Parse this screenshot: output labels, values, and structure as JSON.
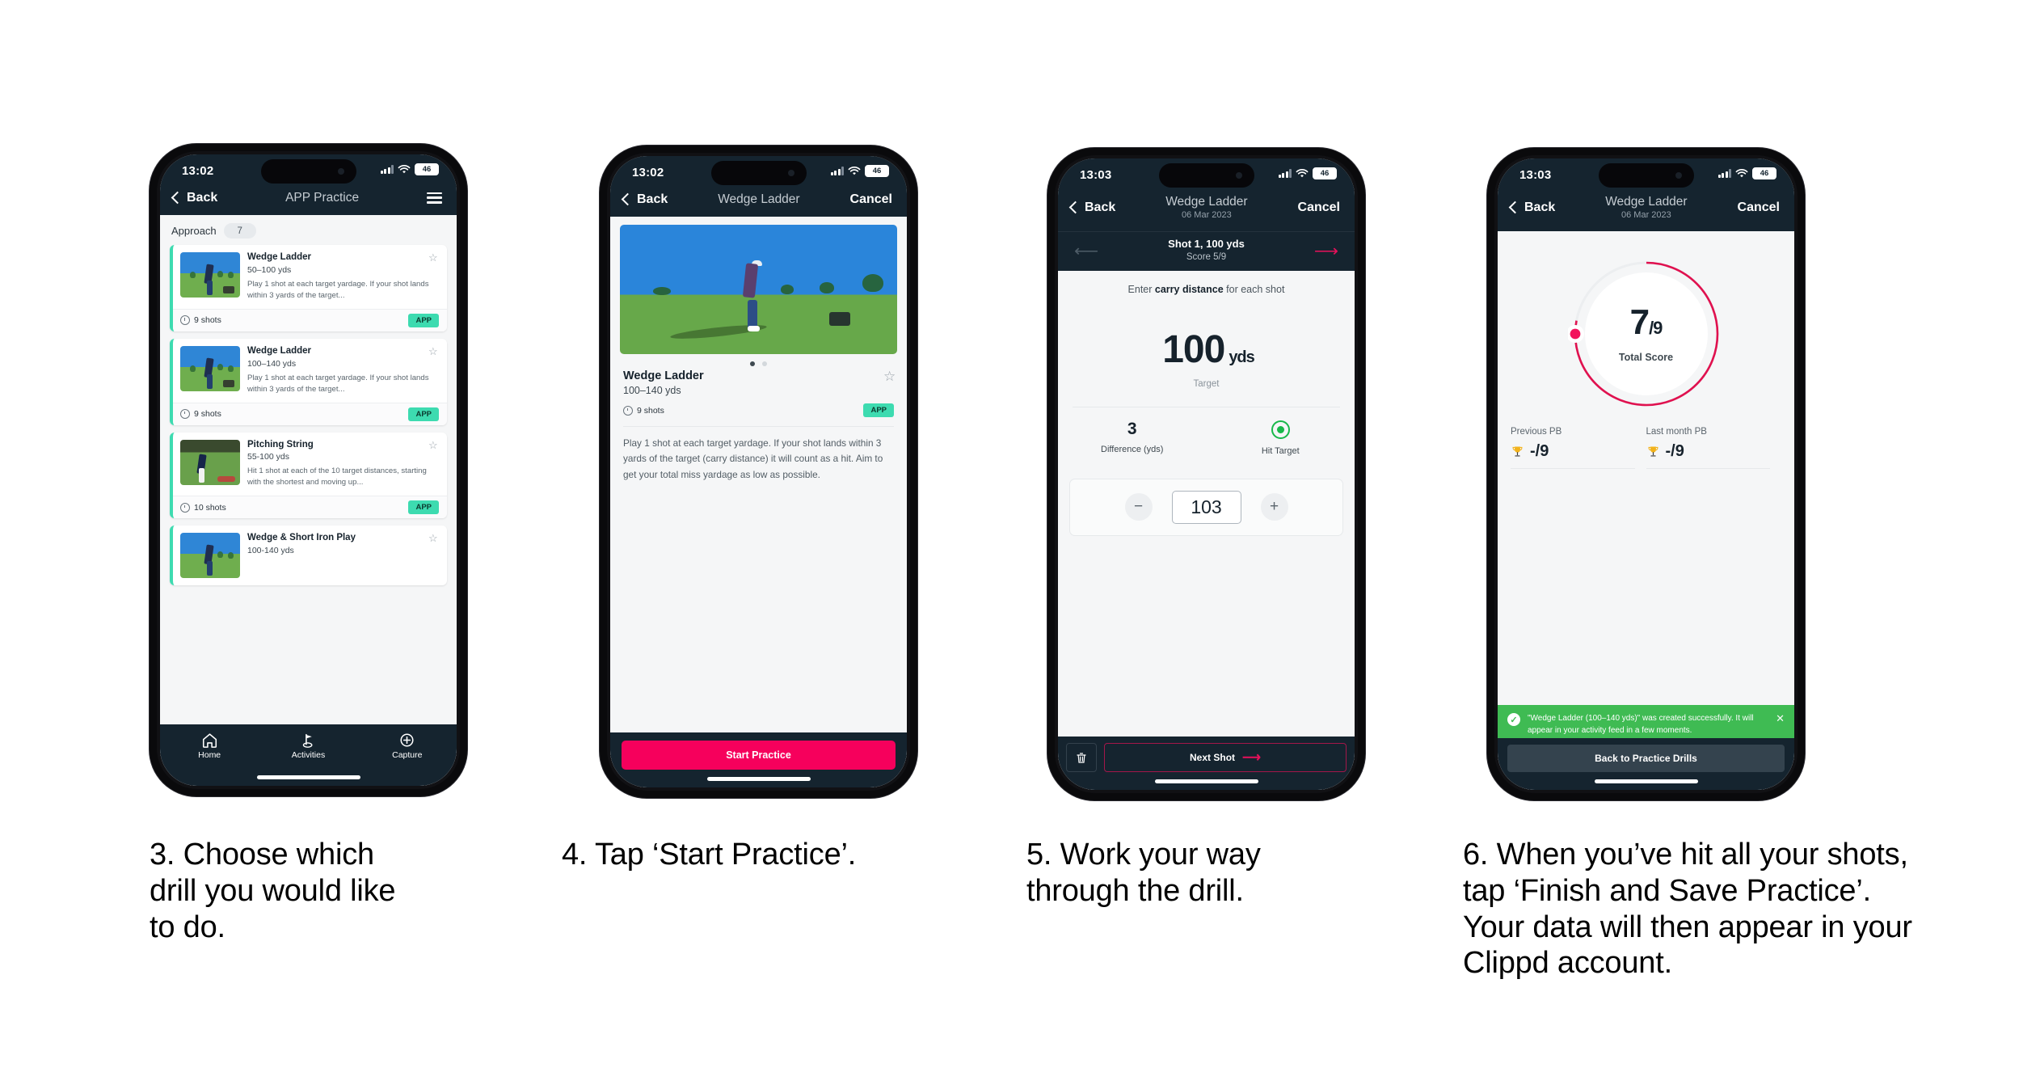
{
  "phones": [
    {
      "id": "phone-app-practice",
      "status": {
        "time": "13:02",
        "battery": "46"
      },
      "nav": {
        "back": "Back",
        "title": "APP Practice",
        "menu_icon": "hamburger-icon"
      },
      "section": {
        "label": "Approach",
        "count": "7"
      },
      "cards": [
        {
          "title": "Wedge Ladder",
          "yardage": "50–100 yds",
          "desc": "Play 1 shot at each target yardage. If your shot lands within 3 yards of the target...",
          "shots": "9 shots",
          "tag": "APP"
        },
        {
          "title": "Wedge Ladder",
          "yardage": "100–140 yds",
          "desc": "Play 1 shot at each target yardage. If your shot lands within 3 yards of the target...",
          "shots": "9 shots",
          "tag": "APP"
        },
        {
          "title": "Pitching String",
          "yardage": "55-100 yds",
          "desc": "Hit 1 shot at each of the 10 target distances, starting with the shortest and moving up...",
          "shots": "10 shots",
          "tag": "APP"
        },
        {
          "title": "Wedge & Short Iron Play",
          "yardage": "100-140 yds",
          "desc": "",
          "shots": "",
          "tag": ""
        }
      ],
      "tabs": [
        {
          "label": "Home",
          "icon": "home-icon"
        },
        {
          "label": "Activities",
          "icon": "golf-flag-icon"
        },
        {
          "label": "Capture",
          "icon": "plus-circle-icon"
        }
      ]
    },
    {
      "id": "phone-drill-detail",
      "status": {
        "time": "13:02",
        "battery": "46"
      },
      "nav": {
        "back": "Back",
        "title": "Wedge Ladder",
        "cancel": "Cancel"
      },
      "detail": {
        "title": "Wedge Ladder",
        "yardage": "100–140 yds",
        "shots": "9 shots",
        "tag": "APP",
        "description": "Play 1 shot at each target yardage. If your shot lands within 3 yards of the target (carry distance) it will count as a hit. Aim to get your total miss yardage as low as possible."
      },
      "cta": "Start Practice"
    },
    {
      "id": "phone-shot-entry",
      "status": {
        "time": "13:03",
        "battery": "46"
      },
      "nav": {
        "back": "Back",
        "title": "Wedge Ladder",
        "subtitle": "06 Mar 2023",
        "cancel": "Cancel"
      },
      "shotbar": {
        "title": "Shot 1, 100 yds",
        "score": "Score 5/9"
      },
      "prompt_before": "Enter ",
      "prompt_bold": "carry distance",
      "prompt_after": " for each shot",
      "target": {
        "value": "100",
        "unit": "yds",
        "label": "Target"
      },
      "difference": {
        "value": "3",
        "label": "Difference (yds)"
      },
      "hit": {
        "label": "Hit Target",
        "color": "#18b84a"
      },
      "stepper": {
        "minus": "−",
        "value": "103",
        "plus": "+"
      },
      "footer": {
        "delete_icon": "trash-icon",
        "next": "Next Shot"
      }
    },
    {
      "id": "phone-summary",
      "status": {
        "time": "13:03",
        "battery": "46"
      },
      "nav": {
        "back": "Back",
        "title": "Wedge Ladder",
        "subtitle": "06 Mar 2023",
        "cancel": "Cancel"
      },
      "ring": {
        "score": "7",
        "total": "/9",
        "label": "Total Score",
        "progress_pct": 78,
        "color": "#e0114f"
      },
      "pb": [
        {
          "label": "Previous PB",
          "value": "-/9",
          "icon": "trophy-icon"
        },
        {
          "label": "Last month PB",
          "value": "-/9",
          "icon": "trophy-icon"
        }
      ],
      "toast": {
        "message": "\"Wedge Ladder (100–140 yds)\" was created successfully. It will appear in your activity feed in a few moments.",
        "icon": "check-circle-icon",
        "close": "✕",
        "color": "#3fbb53"
      },
      "button": "Back to Practice Drills"
    }
  ],
  "captions": [
    "3. Choose which drill you would like to do.",
    "4. Tap ‘Start Practice’.",
    "5. Work your way through the drill.",
    "6. When you’ve hit all your shots, tap ‘Finish and Save Practice’. Your data will then appear in your Clippd account."
  ],
  "theme": {
    "header": "#15242f",
    "accent_pink": "#f6005c",
    "accent_teal": "#3ddbb0",
    "success": "#3fbb53"
  }
}
